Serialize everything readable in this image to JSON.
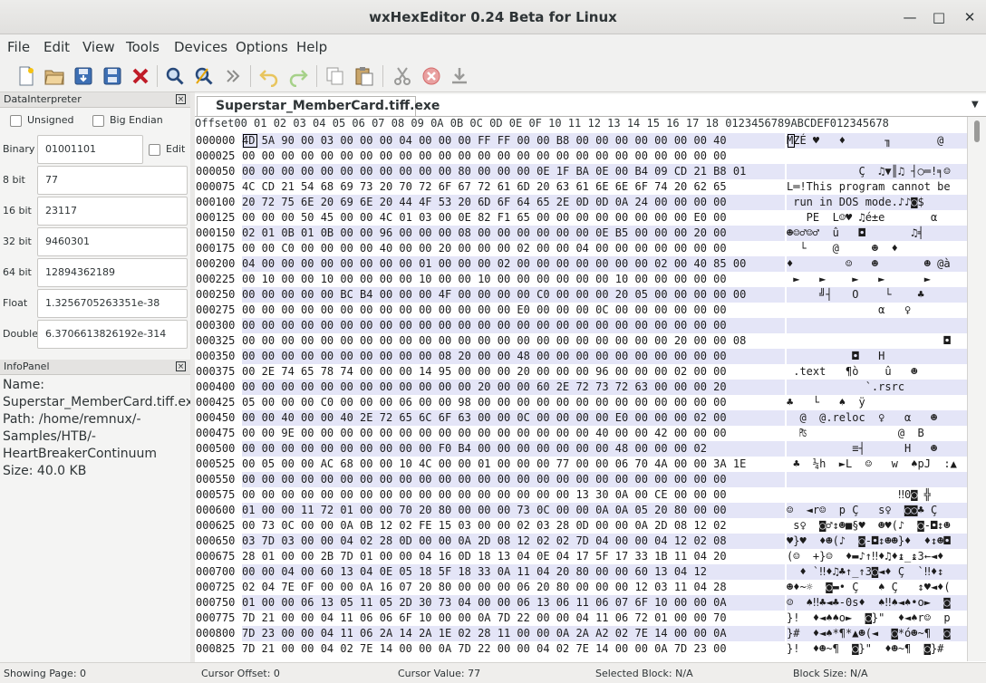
{
  "window": {
    "title": "wxHexEditor 0.24 Beta for Linux",
    "minimize": "—",
    "maximize": "□",
    "close": "✕"
  },
  "menu": [
    "File",
    "Edit",
    "View",
    "Tools",
    "Devices",
    "Options",
    "Help"
  ],
  "toolbar_icons": [
    "new-file-icon",
    "open-file-icon",
    "save-icon",
    "save-as-icon",
    "close-file-icon",
    "find-icon",
    "replace-icon",
    "goto-icon",
    "undo-icon",
    "redo-icon",
    "copy-icon",
    "paste-icon",
    "cut-icon",
    "delete-icon",
    "insert-icon"
  ],
  "data_interpreter": {
    "title": "DataInterpreter",
    "unsigned_label": "Unsigned",
    "big_endian_label": "Big Endian",
    "edit_label": "Edit",
    "rows": [
      {
        "label": "Binary",
        "value": "01001101"
      },
      {
        "label": "8 bit",
        "value": "77"
      },
      {
        "label": "16 bit",
        "value": "23117"
      },
      {
        "label": "32 bit",
        "value": "9460301"
      },
      {
        "label": "64 bit",
        "value": "12894362189"
      },
      {
        "label": "Float",
        "value": "1.3256705263351e-38"
      },
      {
        "label": "Double",
        "value": "6.3706613826192e-314"
      }
    ]
  },
  "info_panel": {
    "title": "InfoPanel",
    "lines": [
      "Name:",
      "Superstar_MemberCard.tiff.ex",
      "Path:     /home/remnux/-",
      "Samples/HTB/-",
      "HeartBreakerContinuum",
      "Size:      40.0 KB"
    ]
  },
  "tab": {
    "label": "Superstar_MemberCard.tiff.exe"
  },
  "hex_header": "Offset00 01 02 03 04 05 06 07 08 09 0A 0B 0C 0D 0E 0F 10 11 12 13 14 15 16 17 18 0123456789ABCDEF012345678",
  "hex_rows": [
    {
      "off": "000000",
      "hex": "4D 5A 90 00 03 00 00 00 04 00 00 00 FF FF 00 00 B8 00 00 00 00 00 00 00 40",
      "txt": "MZÉ ♥   ♦      ╖       @"
    },
    {
      "off": "000025",
      "hex": "00 00 00 00 00 00 00 00 00 00 00 00 00 00 00 00 00 00 00 00 00 00 00 00 00",
      "txt": ""
    },
    {
      "off": "000050",
      "hex": "00 00 00 00 00 00 00 00 00 00 00 80 00 00 00 0E 1F BA 0E 00 B4 09 CD 21 B8 01",
      "txt": "           Ç  ♫▼║♫ ┤○═!╕☺"
    },
    {
      "off": "000075",
      "hex": "4C CD 21 54 68 69 73 20 70 72 6F 67 72 61 6D 20 63 61 6E 6E 6F 74 20 62 65",
      "txt": "L═!This program cannot be"
    },
    {
      "off": "000100",
      "hex": "20 72 75 6E 20 69 6E 20 44 4F 53 20 6D 6F 64 65 2E 0D 0D 0A 24 00 00 00 00",
      "txt": " run in DOS mode.♪♪◙$"
    },
    {
      "off": "000125",
      "hex": "00 00 00 50 45 00 00 4C 01 03 00 0E 82 F1 65 00 00 00 00 00 00 00 00 E0 00",
      "txt": "   PE  L☺♥ ♫é±e       α"
    },
    {
      "off": "000150",
      "hex": "02 01 0B 01 0B 00 00 96 00 00 00 08 00 00 00 00 00 00 0E B5 00 00 00 20 00",
      "txt": "☻☺♂☺♂  û   ◘       ♫╡   "
    },
    {
      "off": "000175",
      "hex": "00 00 C0 00 00 00 00 40 00 00 20 00 00 00 02 00 00 04 00 00 00 00 00 00 00",
      "txt": "  └    @     ☻  ♦       "
    },
    {
      "off": "000200",
      "hex": "04 00 00 00 00 00 00 00 00 01 00 00 00 02 00 00 00 00 00 00 00 02 00 40 85 00",
      "txt": "♦        ☺   ☻       ☻ @à"
    },
    {
      "off": "000225",
      "hex": "00 10 00 00 10 00 00 00 00 10 00 00 10 00 00 00 00 00 00 10 00 00 00 00 00",
      "txt": " ►   ►    ►   ►      ►     "
    },
    {
      "off": "000250",
      "hex": "00 00 00 00 00 BC B4 00 00 00 4F 00 00 00 00 C0 00 00 00 20 05 00 00 00 00 00",
      "txt": "     ╝┤   O    └    ♣    "
    },
    {
      "off": "000275",
      "hex": "00 00 00 00 00 00 00 00 00 00 00 00 00 00 E0 00 00 00 0C 00 00 00 00 00 00",
      "txt": "              α   ♀      "
    },
    {
      "off": "000300",
      "hex": "00 00 00 00 00 00 00 00 00 00 00 00 00 00 00 00 00 00 00 00 00 00 00 00 00",
      "txt": ""
    },
    {
      "off": "000325",
      "hex": "00 00 00 00 00 00 00 00 00 00 00 00 00 00 00 00 00 00 00 00 00 00 20 00 00 08",
      "txt": "                        ◘"
    },
    {
      "off": "000350",
      "hex": "00 00 00 00 00 00 00 00 00 00 08 20 00 00 48 00 00 00 00 00 00 00 00 00 00",
      "txt": "          ◘   H          "
    },
    {
      "off": "000375",
      "hex": "00 2E 74 65 78 74 00 00 00 14 95 00 00 00 20 00 00 00 96 00 00 00 02 00 00",
      "txt": " .text   ¶ò    û   ☻  "
    },
    {
      "off": "000400",
      "hex": "00 00 00 00 00 00 00 00 00 00 00 00 20 00 00 60 2E 72 73 72 63 00 00 00 20",
      "txt": "            `.rsrc    "
    },
    {
      "off": "000425",
      "hex": "05 00 00 00 C0 00 00 00 06 00 00 98 00 00 00 00 00 00 00 00 00 00 00 00 00",
      "txt": "♣   └   ♠  ÿ             "
    },
    {
      "off": "000450",
      "hex": "00 00 40 00 00 40 2E 72 65 6C 6F 63 00 00 0C 00 00 00 00 E0 00 00 00 02 00",
      "txt": "  @  @.reloc  ♀   α   ☻ "
    },
    {
      "off": "000475",
      "hex": "00 00 9E 00 00 00 00 00 00 00 00 00 00 00 00 00 00 00 40 00 00 42 00 00 00",
      "txt": "  ₧              @  B   "
    },
    {
      "off": "000500",
      "hex": "00 00 00 00 00 00 00 00 00 00 F0 B4 00 00 00 00 00 00 00 48 00 00 00 02",
      "txt": "          ≡┤      H   ☻"
    },
    {
      "off": "000525",
      "hex": "00 05 00 00 AC 68 00 00 10 4C 00 00 01 00 00 00 77 00 00 06 70 4A 00 00 3A 1E",
      "txt": " ♣  ¼h  ►L  ☺   w  ♠pJ  :▲"
    },
    {
      "off": "000550",
      "hex": "00 00 00 00 00 00 00 00 00 00 00 00 00 00 00 00 00 00 00 00 00 00 00 00 00",
      "txt": ""
    },
    {
      "off": "000575",
      "hex": "00 00 00 00 00 00 00 00 00 00 00 00 00 00 00 00 00 13 30 0A 00 CE 00 00 00",
      "txt": "                 ‼0◙ ╬   "
    },
    {
      "off": "000600",
      "hex": "01 00 00 11 72 01 00 00 70 20 80 00 00 00 73 0C 00 00 0A 0A 05 20 80 00 00",
      "txt": "☺  ◄r☺  p Ç   s♀  ◙◙♣ Ç  "
    },
    {
      "off": "000625",
      "hex": "00 73 0C 00 00 0A 0B 12 02 FE 15 03 00 00 02 03 28 0D 00 00 0A 2D 08 12 02",
      "txt": " s♀  ◙♂↕☻■§♥  ☻♥(♪  ◙-◘↕☻"
    },
    {
      "off": "000650",
      "hex": "03 7D 03 00 00 04 02 28 0D 00 00 0A 2D 08 12 02 02 7D 04 00 00 04 12 02 08",
      "txt": "♥}♥  ♦☻(♪  ◙-◘↕☻☻}♦  ♦↕☻◘"
    },
    {
      "off": "000675",
      "hex": "28 01 00 00 2B 7D 01 00 00 04 16 0D 18 13 04 0E 04 17 5F 17 33 1B 11 04 20",
      "txt": "(☺  +}☺  ♦▬♪↑‼♦♫♦↨_↨3←◄♦ "
    },
    {
      "off": "000700",
      "hex": "00 00 04 00 60 13 04 0E 05 18 5F 18 33 0A 11 04 20 80 00 00 60 13 04 12",
      "txt": "  ♦ `‼♦♫♣↑_↑3◙◄♦ Ç  `‼♦↕"
    },
    {
      "off": "000725",
      "hex": "02 04 7E 0F 00 00 0A 16 07 20 80 00 00 00 06 20 80 00 00 00 12 03 11 04 28",
      "txt": "☻♦~☼  ◙▬• Ç   ♠ Ç   ↕♥◄♦("
    },
    {
      "off": "000750",
      "hex": "01 00 00 06 13 05 11 05 2D 30 73 04 00 00 06 13 06 11 06 07 6F 10 00 00 0A",
      "txt": "☺  ♠‼♣◄♣-0s♦  ♠‼♠◄♠•o►  ◙"
    },
    {
      "off": "000775",
      "hex": "7D 21 00 00 04 11 06 06 6F 10 00 00 0A 7D 22 00 00 04 11 06 72 01 00 00 70",
      "txt": "}!  ♦◄♠♠o►  ◙}\"  ♦◄♠r☺  p"
    },
    {
      "off": "000800",
      "hex": "7D 23 00 00 04 11 06 2A 14 2A 1E 02 28 11 00 00 0A 2A A2 02 7E 14 00 00 0A",
      "txt": "}#  ♦◄♠*¶*▲☻(◄  ◙*ó☻~¶  ◙"
    },
    {
      "off": "000825",
      "hex": "7D 21 00 00 04 02 7E 14 00 00 0A 7D 22 00 00 04 02 7E 14 00 00 0A 7D 23 00",
      "txt": "}!  ♦☻~¶  ◙}\"  ♦☻~¶  ◙}# "
    }
  ],
  "status": {
    "page": "Showing Page: 0",
    "cursor_offset": "Cursor Offset: 0",
    "cursor_value": "Cursor Value: 77",
    "selected_block": "Selected Block: N/A",
    "block_size": "Block Size: N/A"
  }
}
